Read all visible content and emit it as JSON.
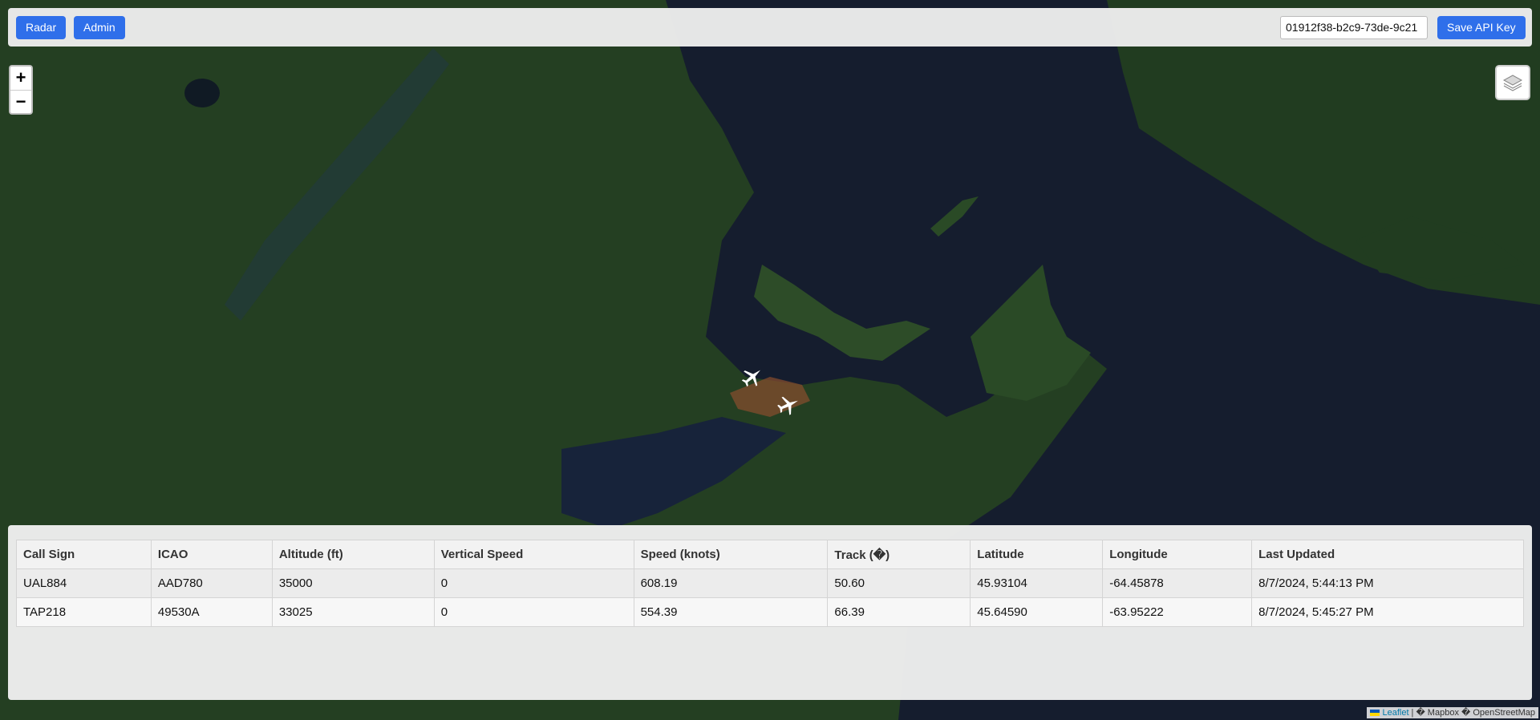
{
  "toolbar": {
    "radar_label": "Radar",
    "admin_label": "Admin",
    "api_key_value": "01912f38-b2c9-73de-9c21",
    "save_label": "Save API Key"
  },
  "map": {
    "zoom_in": "+",
    "zoom_out": "−",
    "layers_icon": "layers-icon",
    "plane_icon": "airplane-icon"
  },
  "table": {
    "headers": [
      "Call Sign",
      "ICAO",
      "Altitude (ft)",
      "Vertical Speed",
      "Speed (knots)",
      "Track (�)",
      "Latitude",
      "Longitude",
      "Last Updated"
    ],
    "rows": [
      [
        "UAL884",
        "AAD780",
        "35000",
        "0",
        "608.19",
        "50.60",
        "45.93104",
        "-64.45878",
        "8/7/2024, 5:44:13 PM"
      ],
      [
        "TAP218",
        "49530A",
        "33025",
        "0",
        "554.39",
        "66.39",
        "45.64590",
        "-63.95222",
        "8/7/2024, 5:45:27 PM"
      ]
    ]
  },
  "attribution": {
    "leaflet": "Leaflet",
    "rest": " | � Mapbox � OpenStreetMap"
  },
  "colors": {
    "button": "#2f6fea",
    "ocean": "#141c2c",
    "land": "#2a4a26"
  }
}
